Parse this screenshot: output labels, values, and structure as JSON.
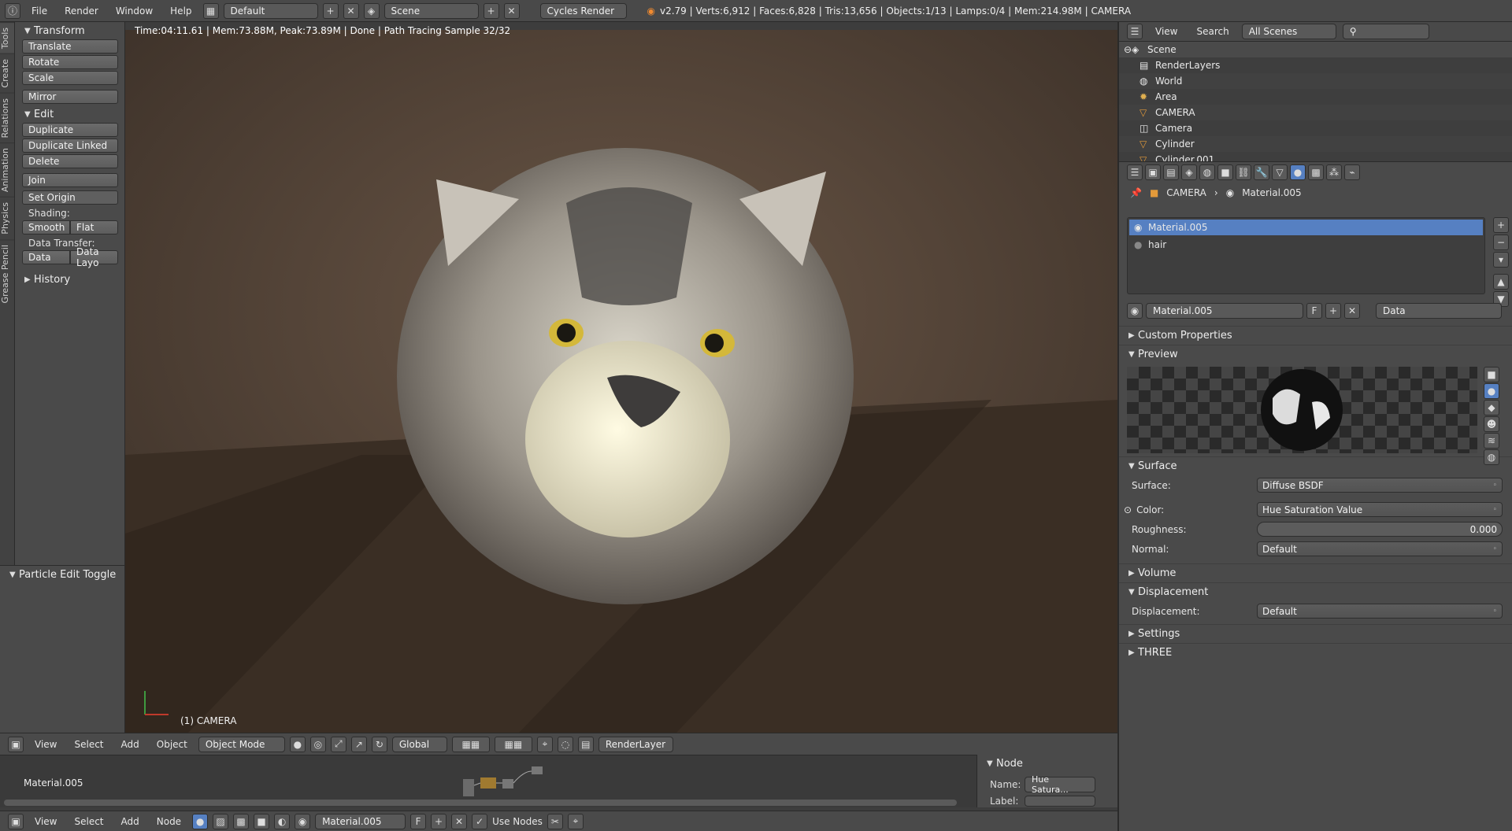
{
  "topbar": {
    "menus": [
      "File",
      "Render",
      "Window",
      "Help"
    ],
    "layout": "Default",
    "scene": "Scene",
    "engine": "Cycles Render",
    "stats": "v2.79 | Verts:6,912 | Faces:6,828 | Tris:13,656 | Objects:1/13 | Lamps:0/4 | Mem:214.98M | CAMERA"
  },
  "lefttabs": [
    "Tools",
    "Create",
    "Relations",
    "Animation",
    "Physics",
    "Grease Pencil"
  ],
  "toolshelf": {
    "transform": "Transform",
    "translate": "Translate",
    "rotate": "Rotate",
    "scale": "Scale",
    "mirror": "Mirror",
    "edit": "Edit",
    "duplicate": "Duplicate",
    "duplicate_linked": "Duplicate Linked",
    "delete": "Delete",
    "join": "Join",
    "set_origin": "Set Origin",
    "shading": "Shading:",
    "smooth": "Smooth",
    "flat": "Flat",
    "data_transfer": "Data Transfer:",
    "data": "Data",
    "data_layo": "Data Layo",
    "history": "History",
    "particle_edit": "Particle Edit Toggle"
  },
  "viewport": {
    "render_info": "Time:04:11.61 | Mem:73.88M, Peak:73.89M | Done | Path Tracing Sample 32/32",
    "object_label": "(1) CAMERA"
  },
  "vp_toolbar": {
    "view": "View",
    "select": "Select",
    "add": "Add",
    "object": "Object",
    "mode": "Object Mode",
    "orientation": "Global",
    "render_layer": "RenderLayer"
  },
  "node_editor": {
    "material": "Material.005",
    "node_title": "Node",
    "name_label": "Name:",
    "name_value": "Hue Satura...",
    "label_label": "Label:"
  },
  "bottom_bar": {
    "view": "View",
    "select": "Select",
    "add": "Add",
    "node": "Node",
    "material": "Material.005",
    "fake": "F",
    "use_nodes": "Use Nodes"
  },
  "outliner": {
    "view": "View",
    "search": "Search",
    "scenes": "All Scenes",
    "items": [
      "Scene",
      "RenderLayers",
      "World",
      "Area",
      "CAMERA",
      "Camera",
      "Cylinder",
      "Cylinder.001"
    ]
  },
  "props": {
    "breadcrumb_object": "CAMERA",
    "breadcrumb_material": "Material.005",
    "slots": [
      "Material.005",
      "hair"
    ],
    "material_name": "Material.005",
    "fake": "F",
    "link": "Data",
    "custom_props": "Custom Properties",
    "preview": "Preview",
    "surface_sec": "Surface",
    "surface_label": "Surface:",
    "surface_value": "Diffuse BSDF",
    "color_label": "Color:",
    "color_value": "Hue Saturation Value",
    "roughness_label": "Roughness:",
    "roughness_value": "0.000",
    "normal_label": "Normal:",
    "normal_value": "Default",
    "volume": "Volume",
    "displacement_sec": "Displacement",
    "displacement_label": "Displacement:",
    "displacement_value": "Default",
    "settings": "Settings",
    "three": "THREE"
  },
  "colors": {
    "accent": "#5680c2",
    "panel": "#4a4a4a",
    "header": "#494949"
  }
}
